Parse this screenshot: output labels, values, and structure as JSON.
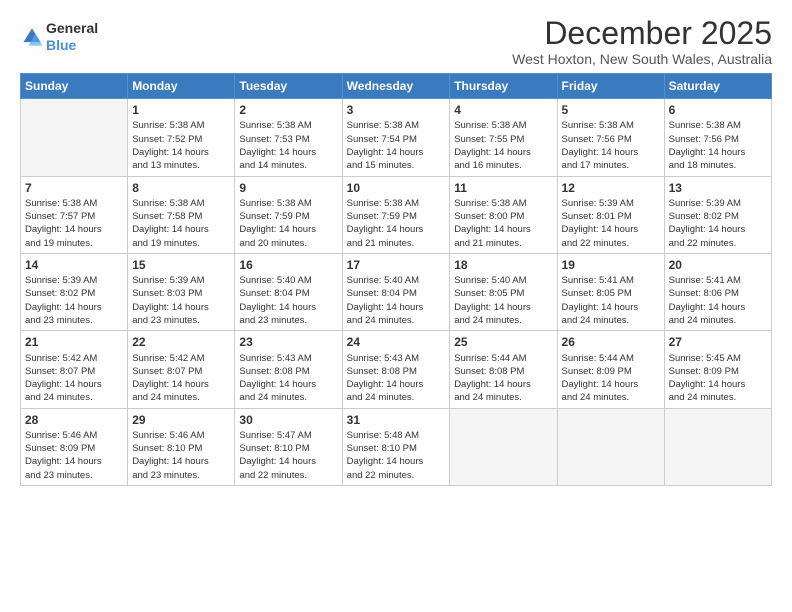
{
  "logo": {
    "general": "General",
    "blue": "Blue"
  },
  "header": {
    "title": "December 2025",
    "subtitle": "West Hoxton, New South Wales, Australia"
  },
  "weekdays": [
    "Sunday",
    "Monday",
    "Tuesday",
    "Wednesday",
    "Thursday",
    "Friday",
    "Saturday"
  ],
  "weeks": [
    [
      {
        "day": "",
        "info": ""
      },
      {
        "day": "1",
        "info": "Sunrise: 5:38 AM\nSunset: 7:52 PM\nDaylight: 14 hours\nand 13 minutes."
      },
      {
        "day": "2",
        "info": "Sunrise: 5:38 AM\nSunset: 7:53 PM\nDaylight: 14 hours\nand 14 minutes."
      },
      {
        "day": "3",
        "info": "Sunrise: 5:38 AM\nSunset: 7:54 PM\nDaylight: 14 hours\nand 15 minutes."
      },
      {
        "day": "4",
        "info": "Sunrise: 5:38 AM\nSunset: 7:55 PM\nDaylight: 14 hours\nand 16 minutes."
      },
      {
        "day": "5",
        "info": "Sunrise: 5:38 AM\nSunset: 7:56 PM\nDaylight: 14 hours\nand 17 minutes."
      },
      {
        "day": "6",
        "info": "Sunrise: 5:38 AM\nSunset: 7:56 PM\nDaylight: 14 hours\nand 18 minutes."
      }
    ],
    [
      {
        "day": "7",
        "info": "Sunrise: 5:38 AM\nSunset: 7:57 PM\nDaylight: 14 hours\nand 19 minutes."
      },
      {
        "day": "8",
        "info": "Sunrise: 5:38 AM\nSunset: 7:58 PM\nDaylight: 14 hours\nand 19 minutes."
      },
      {
        "day": "9",
        "info": "Sunrise: 5:38 AM\nSunset: 7:59 PM\nDaylight: 14 hours\nand 20 minutes."
      },
      {
        "day": "10",
        "info": "Sunrise: 5:38 AM\nSunset: 7:59 PM\nDaylight: 14 hours\nand 21 minutes."
      },
      {
        "day": "11",
        "info": "Sunrise: 5:38 AM\nSunset: 8:00 PM\nDaylight: 14 hours\nand 21 minutes."
      },
      {
        "day": "12",
        "info": "Sunrise: 5:39 AM\nSunset: 8:01 PM\nDaylight: 14 hours\nand 22 minutes."
      },
      {
        "day": "13",
        "info": "Sunrise: 5:39 AM\nSunset: 8:02 PM\nDaylight: 14 hours\nand 22 minutes."
      }
    ],
    [
      {
        "day": "14",
        "info": "Sunrise: 5:39 AM\nSunset: 8:02 PM\nDaylight: 14 hours\nand 23 minutes."
      },
      {
        "day": "15",
        "info": "Sunrise: 5:39 AM\nSunset: 8:03 PM\nDaylight: 14 hours\nand 23 minutes."
      },
      {
        "day": "16",
        "info": "Sunrise: 5:40 AM\nSunset: 8:04 PM\nDaylight: 14 hours\nand 23 minutes."
      },
      {
        "day": "17",
        "info": "Sunrise: 5:40 AM\nSunset: 8:04 PM\nDaylight: 14 hours\nand 24 minutes."
      },
      {
        "day": "18",
        "info": "Sunrise: 5:40 AM\nSunset: 8:05 PM\nDaylight: 14 hours\nand 24 minutes."
      },
      {
        "day": "19",
        "info": "Sunrise: 5:41 AM\nSunset: 8:05 PM\nDaylight: 14 hours\nand 24 minutes."
      },
      {
        "day": "20",
        "info": "Sunrise: 5:41 AM\nSunset: 8:06 PM\nDaylight: 14 hours\nand 24 minutes."
      }
    ],
    [
      {
        "day": "21",
        "info": "Sunrise: 5:42 AM\nSunset: 8:07 PM\nDaylight: 14 hours\nand 24 minutes."
      },
      {
        "day": "22",
        "info": "Sunrise: 5:42 AM\nSunset: 8:07 PM\nDaylight: 14 hours\nand 24 minutes."
      },
      {
        "day": "23",
        "info": "Sunrise: 5:43 AM\nSunset: 8:08 PM\nDaylight: 14 hours\nand 24 minutes."
      },
      {
        "day": "24",
        "info": "Sunrise: 5:43 AM\nSunset: 8:08 PM\nDaylight: 14 hours\nand 24 minutes."
      },
      {
        "day": "25",
        "info": "Sunrise: 5:44 AM\nSunset: 8:08 PM\nDaylight: 14 hours\nand 24 minutes."
      },
      {
        "day": "26",
        "info": "Sunrise: 5:44 AM\nSunset: 8:09 PM\nDaylight: 14 hours\nand 24 minutes."
      },
      {
        "day": "27",
        "info": "Sunrise: 5:45 AM\nSunset: 8:09 PM\nDaylight: 14 hours\nand 24 minutes."
      }
    ],
    [
      {
        "day": "28",
        "info": "Sunrise: 5:46 AM\nSunset: 8:09 PM\nDaylight: 14 hours\nand 23 minutes."
      },
      {
        "day": "29",
        "info": "Sunrise: 5:46 AM\nSunset: 8:10 PM\nDaylight: 14 hours\nand 23 minutes."
      },
      {
        "day": "30",
        "info": "Sunrise: 5:47 AM\nSunset: 8:10 PM\nDaylight: 14 hours\nand 22 minutes."
      },
      {
        "day": "31",
        "info": "Sunrise: 5:48 AM\nSunset: 8:10 PM\nDaylight: 14 hours\nand 22 minutes."
      },
      {
        "day": "",
        "info": ""
      },
      {
        "day": "",
        "info": ""
      },
      {
        "day": "",
        "info": ""
      }
    ]
  ]
}
